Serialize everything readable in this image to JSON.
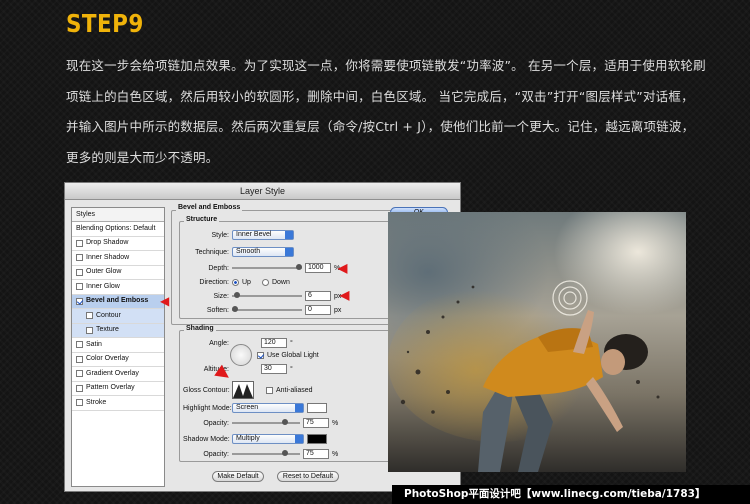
{
  "step": {
    "title": "STEP9"
  },
  "paragraph": "现在这一步会给项链加点效果。为了实现这一点，你将需要使项链散发“功率波”。 在另一个层，适用于使用软轮刷项链上的白色区域，然后用较小的软圆形，删除中间，白色区域。 当它完成后，“双击”打开“图层样式”对话框，并输入图片中所示的数据层。然后两次重复层（命令/按Ctrl + J），使他们比前一个更大。记住，越远离项链波，更多的则是大而少不透明。",
  "dialog": {
    "title": "Layer Style",
    "styles_header": "Styles",
    "styles": [
      {
        "label": "Blending Options: Default"
      },
      {
        "label": "Drop Shadow"
      },
      {
        "label": "Inner Shadow"
      },
      {
        "label": "Outer Glow"
      },
      {
        "label": "Inner Glow"
      },
      {
        "label": "Bevel and Emboss"
      },
      {
        "label": "Contour"
      },
      {
        "label": "Texture"
      },
      {
        "label": "Satin"
      },
      {
        "label": "Color Overlay"
      },
      {
        "label": "Gradient Overlay"
      },
      {
        "label": "Pattern Overlay"
      },
      {
        "label": "Stroke"
      }
    ],
    "bevel": {
      "group_title": "Bevel and Emboss",
      "structure_title": "Structure",
      "style_label": "Style:",
      "style_value": "Inner Bevel",
      "technique_label": "Technique:",
      "technique_value": "Smooth",
      "depth_label": "Depth:",
      "depth_value": "1000",
      "depth_unit": "%",
      "direction_label": "Direction:",
      "direction_up": "Up",
      "direction_down": "Down",
      "size_label": "Size:",
      "size_value": "6",
      "size_unit": "px",
      "soften_label": "Soften:",
      "soften_value": "0",
      "soften_unit": "px"
    },
    "shading": {
      "title": "Shading",
      "angle_label": "Angle:",
      "angle_value": "120",
      "angle_unit": "°",
      "global_light": "Use Global Light",
      "altitude_label": "Altitude:",
      "altitude_value": "30",
      "altitude_unit": "°",
      "gloss_label": "Gloss Contour:",
      "anti_aliased": "Anti-aliased",
      "highlight_label": "Highlight Mode:",
      "highlight_value": "Screen",
      "opacity_label": "Opacity:",
      "highlight_opacity": "75",
      "shadow_label": "Shadow Mode:",
      "shadow_value": "Multiply",
      "shadow_opacity": "75",
      "pct": "%"
    },
    "buttons": {
      "make_default": "Make Default",
      "reset_default": "Reset to Default",
      "ok": "OK"
    },
    "colors": {
      "highlight": "#ffffff",
      "shadow": "#000000"
    }
  },
  "footer": "PhotoShop平面设计吧【www.linecg.com/tieba/1783】"
}
